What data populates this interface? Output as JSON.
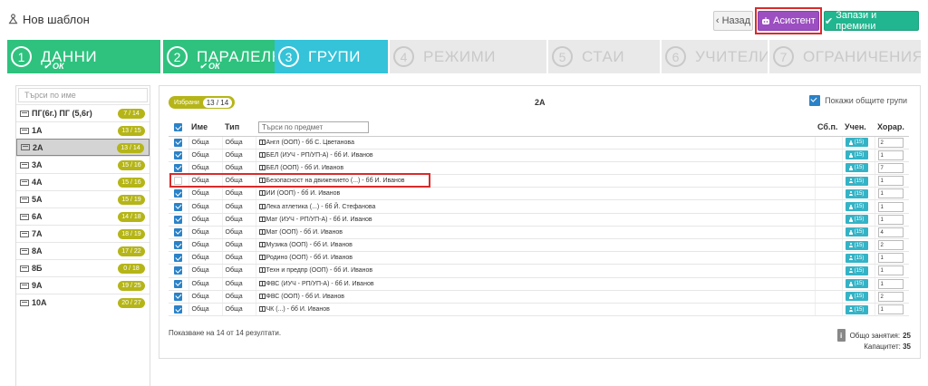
{
  "app": {
    "title": "Нов шаблон"
  },
  "toolbar": {
    "back_label": "Назад",
    "assistant_label": "Асистент",
    "save_label": "Запази и премини"
  },
  "steps": [
    {
      "num": "1",
      "label": "ДАННИ",
      "status": "ОК",
      "state": "done"
    },
    {
      "num": "2",
      "label": "ПАРАЛЕЛКИ",
      "status": "ОК",
      "state": "done"
    },
    {
      "num": "3",
      "label": "ГРУПИ",
      "status": "",
      "state": "active"
    },
    {
      "num": "4",
      "label": "РЕЖИМИ",
      "status": "",
      "state": "todo"
    },
    {
      "num": "5",
      "label": "СТАИ",
      "status": "",
      "state": "todo"
    },
    {
      "num": "6",
      "label": "УЧИТЕЛИ",
      "status": "",
      "state": "todo"
    },
    {
      "num": "7",
      "label": "ОГРАНИЧЕНИЯ",
      "status": "",
      "state": "todo"
    }
  ],
  "sidebar": {
    "search_placeholder": "Търси по име",
    "items": [
      {
        "name": "ПГ(6г.) ПГ (5,6г)",
        "count": "7 / 14"
      },
      {
        "name": "1А",
        "count": "13 / 15"
      },
      {
        "name": "2А",
        "count": "13 / 14"
      },
      {
        "name": "3А",
        "count": "15 / 16"
      },
      {
        "name": "4А",
        "count": "15 / 16"
      },
      {
        "name": "5А",
        "count": "15 / 19"
      },
      {
        "name": "6А",
        "count": "14 / 18"
      },
      {
        "name": "7А",
        "count": "18 / 19"
      },
      {
        "name": "8А",
        "count": "17 / 22"
      },
      {
        "name": "8Б",
        "count": "0 / 18"
      },
      {
        "name": "9А",
        "count": "19 / 25"
      },
      {
        "name": "10А",
        "count": "20 / 27"
      }
    ]
  },
  "main": {
    "selected_label": "Избрани",
    "selected_count": "13 / 14",
    "class_heading": "2А",
    "show_common_label": "Покажи общите групи",
    "columns": {
      "name": "Име",
      "type": "Тип",
      "search_placeholder": "Търси по предмет",
      "sb": "Сб.п.",
      "teacher": "Учен.",
      "hours": "Хорар."
    },
    "teacher_btn_label": "(15)",
    "rows": [
      {
        "name": "Обща",
        "type": "Обща",
        "subject": "Англ (ООП) - бб С. Цветанова",
        "hours": "2"
      },
      {
        "name": "Обща",
        "type": "Обща",
        "subject": "БЕЛ (ИУЧ - РП/УП-А) - бб И. Иванов",
        "hours": "1"
      },
      {
        "name": "Обща",
        "type": "Обща",
        "subject": "БЕЛ (ООП) - бб И. Иванов",
        "hours": "7"
      },
      {
        "name": "Обща",
        "type": "Обща",
        "subject": "Безопасност на движението (...) - бб И. Иванов",
        "hours": "1"
      },
      {
        "name": "Обща",
        "type": "Обща",
        "subject": "ИИ (ООП) - бб И. Иванов",
        "hours": "1"
      },
      {
        "name": "Обща",
        "type": "Обща",
        "subject": "Лека атлетика (...) - бб Й. Стефанова",
        "hours": "1"
      },
      {
        "name": "Обща",
        "type": "Обща",
        "subject": "Мат (ИУЧ - РП/УП-А) - бб И. Иванов",
        "hours": "1"
      },
      {
        "name": "Обща",
        "type": "Обща",
        "subject": "Мат (ООП) - бб И. Иванов",
        "hours": "4"
      },
      {
        "name": "Обща",
        "type": "Обща",
        "subject": "Музика (ООП) - бб И. Иванов",
        "hours": "2"
      },
      {
        "name": "Обща",
        "type": "Обща",
        "subject": "Родино (ООП) - бб И. Иванов",
        "hours": "1"
      },
      {
        "name": "Обща",
        "type": "Обща",
        "subject": "Техн и предпр (ООП) - бб И. Иванов",
        "hours": "1"
      },
      {
        "name": "Обща",
        "type": "Обща",
        "subject": "ФВС (ИУЧ - РП/УП-А) - бб И. Иванов",
        "hours": "1"
      },
      {
        "name": "Обща",
        "type": "Обща",
        "subject": "ФВС (ООП) - бб И. Иванов",
        "hours": "2"
      },
      {
        "name": "Обща",
        "type": "Обща",
        "subject": "ЧК (...) - бб И. Иванов",
        "hours": "1"
      }
    ],
    "results_info": "Показване на 14 от 14 резултати.",
    "total_label": "Общо занятия:",
    "total_value": "25",
    "capacity_label": "Капацитет:",
    "capacity_value": "35"
  },
  "colors": {
    "done": "#2ec27e",
    "active": "#34c3d9",
    "todo": "#e9e9e9",
    "assistant": "#9b4fc0",
    "save": "#21b68f",
    "badge": "#b5b518",
    "highlight": "#d92b2b"
  },
  "icons": {
    "app": "hierarchy-icon",
    "assistant": "robot-icon",
    "save": "check-icon",
    "subject": "book-icon",
    "teacher": "person-icon",
    "info": "info-icon"
  }
}
